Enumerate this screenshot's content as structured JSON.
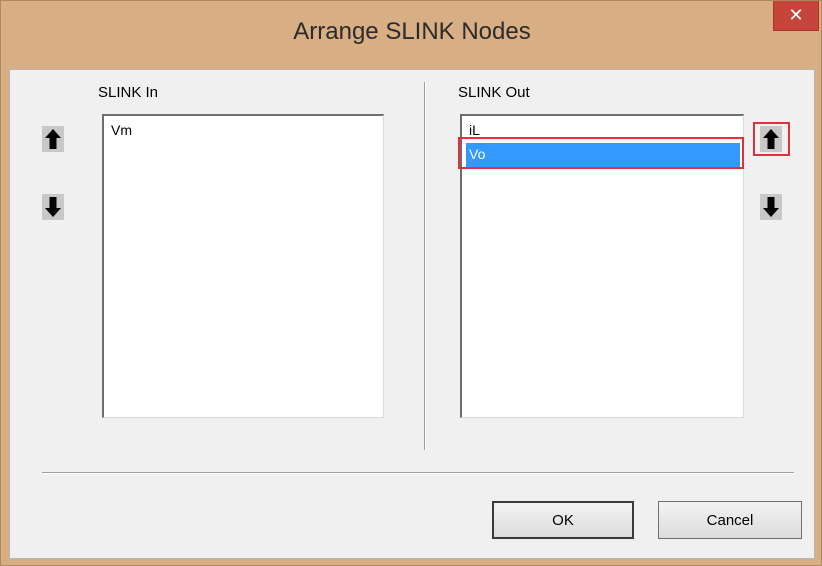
{
  "window": {
    "title": "Arrange SLINK Nodes",
    "close_glyph": "✕"
  },
  "slink_in": {
    "label": "SLINK In",
    "items": [
      "Vm"
    ]
  },
  "slink_out": {
    "label": "SLINK Out",
    "items": [
      "iL",
      "Vo"
    ],
    "selected_item": "Vo"
  },
  "buttons": {
    "ok": "OK",
    "cancel": "Cancel"
  },
  "icons": {
    "in_up": "arrow-up-icon",
    "in_down": "arrow-down-icon",
    "out_up": "arrow-up-icon",
    "out_down": "arrow-down-icon"
  },
  "colors": {
    "title_bar": "#d8ae84",
    "close_button": "#c7443a",
    "selection": "#3399ff",
    "highlight_outline": "#e0303a"
  }
}
